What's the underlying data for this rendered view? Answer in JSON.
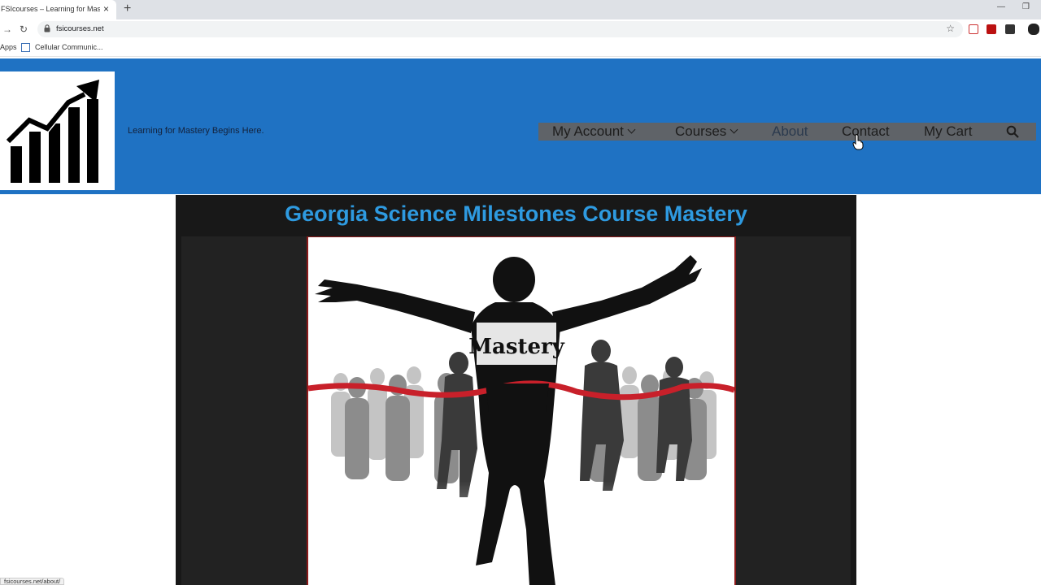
{
  "browser": {
    "tab_title": "FSIcourses – Learning for Mastery",
    "tab_close": "×",
    "new_tab": "+",
    "url": "fsicourses.net",
    "bookmarks": [
      {
        "label": "Apps"
      },
      {
        "label": "Cellular Communic..."
      }
    ],
    "status_url": "fsicourses.net/about/"
  },
  "site": {
    "tagline": "Learning for Mastery Begins Here.",
    "menu": [
      {
        "label": "My Account",
        "has_dropdown": true
      },
      {
        "label": "Courses",
        "has_dropdown": true
      },
      {
        "label": "About",
        "has_dropdown": false
      },
      {
        "label": "Contact",
        "has_dropdown": false
      },
      {
        "label": "My Cart",
        "has_dropdown": false
      }
    ],
    "search_icon": "search-icon"
  },
  "main": {
    "title": "Georgia Science Milestones Course Mastery",
    "hero_text": "Mastery"
  },
  "colors": {
    "header_bg": "#1f72c3",
    "title": "#2e9ae0",
    "content_bg": "#181818",
    "finish_tape": "#c8202a"
  }
}
